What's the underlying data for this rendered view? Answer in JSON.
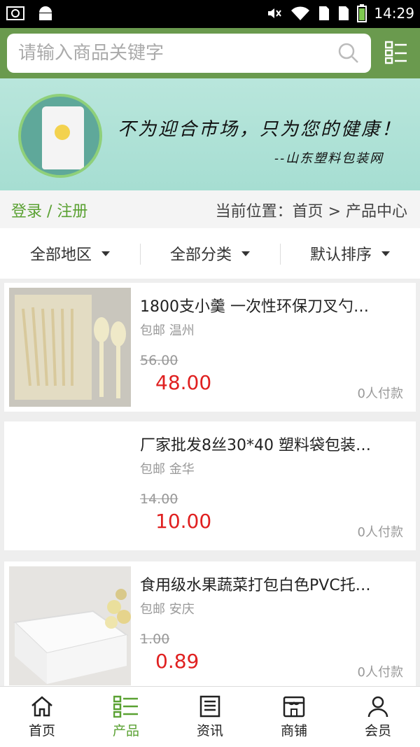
{
  "status_bar": {
    "time": "14:29",
    "left_icons": [
      "screenshot-icon",
      "android-icon"
    ],
    "right_icons": [
      "mute-icon",
      "wifi-icon",
      "sim1-icon",
      "sim2-icon",
      "battery-icon"
    ]
  },
  "search": {
    "placeholder": "请输入商品关键字"
  },
  "banner": {
    "line1": "不为迎合市场，只为您的健康！",
    "line2": "--山东塑料包装网"
  },
  "breadcrumb": {
    "login": "登录 / 注册",
    "position": "当前位置：首页 > 产品中心"
  },
  "filters": [
    {
      "label": "全部地区"
    },
    {
      "label": "全部分类"
    },
    {
      "label": "默认排序"
    }
  ],
  "products": [
    {
      "title": "1800支小羹 一次性环保刀叉勺…",
      "meta": "包邮 温州",
      "old_price": "56.00",
      "price": "48.00",
      "sold": "0人付款"
    },
    {
      "title": "厂家批发8丝30*40 塑料袋包装…",
      "meta": "包邮 金华",
      "old_price": "14.00",
      "price": "10.00",
      "sold": "0人付款"
    },
    {
      "title": "食用级水果蔬菜打包白色PVC托…",
      "meta": "包邮 安庆",
      "old_price": "1.00",
      "price": "0.89",
      "sold": "0人付款"
    }
  ],
  "tabs": [
    {
      "label": "首页",
      "icon": "home-icon"
    },
    {
      "label": "产品",
      "icon": "list-icon",
      "active": true
    },
    {
      "label": "资讯",
      "icon": "news-icon"
    },
    {
      "label": "商铺",
      "icon": "shop-icon"
    },
    {
      "label": "会员",
      "icon": "user-icon"
    }
  ],
  "colors": {
    "brand_green": "#6a9a4e",
    "accent_green": "#5aa132",
    "price_red": "#e02020"
  }
}
